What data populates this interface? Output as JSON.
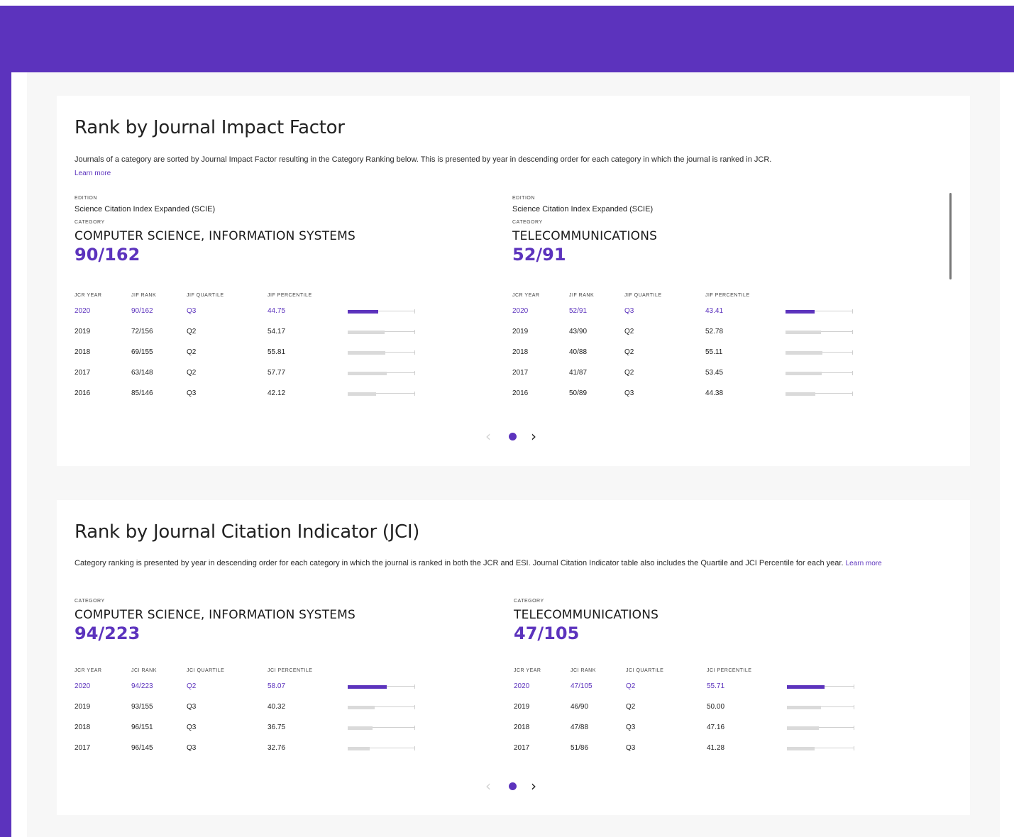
{
  "colors": {
    "accent": "#5c33bd",
    "background": "#f7f7f7",
    "card": "#ffffff"
  },
  "jif": {
    "title": "Rank by Journal Impact Factor",
    "description": "Journals of a category are sorted by Journal Impact Factor resulting in the Category Ranking below. This is presented by year in descending order for each category in which the journal is ranked in JCR.",
    "learn_more": "Learn more",
    "headers": {
      "year": "JCR YEAR",
      "rank": "JIF RANK",
      "quartile": "JIF QUARTILE",
      "percentile": "JIF PERCENTILE"
    },
    "categories": [
      {
        "edition_label": "EDITION",
        "edition": "Science Citation Index Expanded (SCIE)",
        "category_label": "CATEGORY",
        "name": "COMPUTER SCIENCE, INFORMATION SYSTEMS",
        "rank": "90/162",
        "rows": [
          {
            "year": "2020",
            "rank": "90/162",
            "quartile": "Q3",
            "percentile": "44.75",
            "pct": 44.75
          },
          {
            "year": "2019",
            "rank": "72/156",
            "quartile": "Q2",
            "percentile": "54.17",
            "pct": 54.17
          },
          {
            "year": "2018",
            "rank": "69/155",
            "quartile": "Q2",
            "percentile": "55.81",
            "pct": 55.81
          },
          {
            "year": "2017",
            "rank": "63/148",
            "quartile": "Q2",
            "percentile": "57.77",
            "pct": 57.77
          },
          {
            "year": "2016",
            "rank": "85/146",
            "quartile": "Q3",
            "percentile": "42.12",
            "pct": 42.12
          }
        ]
      },
      {
        "edition_label": "EDITION",
        "edition": "Science Citation Index Expanded (SCIE)",
        "category_label": "CATEGORY",
        "name": "TELECOMMUNICATIONS",
        "rank": "52/91",
        "rows": [
          {
            "year": "2020",
            "rank": "52/91",
            "quartile": "Q3",
            "percentile": "43.41",
            "pct": 43.41
          },
          {
            "year": "2019",
            "rank": "43/90",
            "quartile": "Q2",
            "percentile": "52.78",
            "pct": 52.78
          },
          {
            "year": "2018",
            "rank": "40/88",
            "quartile": "Q2",
            "percentile": "55.11",
            "pct": 55.11
          },
          {
            "year": "2017",
            "rank": "41/87",
            "quartile": "Q2",
            "percentile": "53.45",
            "pct": 53.45
          },
          {
            "year": "2016",
            "rank": "50/89",
            "quartile": "Q3",
            "percentile": "44.38",
            "pct": 44.38
          }
        ]
      }
    ]
  },
  "jci": {
    "title": "Rank by Journal Citation Indicator (JCI)",
    "description": "Category ranking is presented by year in descending order for each category in which the journal is ranked in both the JCR and ESI. Journal Citation Indicator table also includes the Quartile and JCI Percentile for each year.",
    "learn_more": "Learn more",
    "headers": {
      "year": "JCR YEAR",
      "rank": "JCI RANK",
      "quartile": "JCI QUARTILE",
      "percentile": "JCI PERCENTILE"
    },
    "categories": [
      {
        "category_label": "CATEGORY",
        "name": "COMPUTER SCIENCE, INFORMATION SYSTEMS",
        "rank": "94/223",
        "rows": [
          {
            "year": "2020",
            "rank": "94/223",
            "quartile": "Q2",
            "percentile": "58.07",
            "pct": 58.07
          },
          {
            "year": "2019",
            "rank": "93/155",
            "quartile": "Q3",
            "percentile": "40.32",
            "pct": 40.32
          },
          {
            "year": "2018",
            "rank": "96/151",
            "quartile": "Q3",
            "percentile": "36.75",
            "pct": 36.75
          },
          {
            "year": "2017",
            "rank": "96/145",
            "quartile": "Q3",
            "percentile": "32.76",
            "pct": 32.76
          }
        ]
      },
      {
        "category_label": "CATEGORY",
        "name": "TELECOMMUNICATIONS",
        "rank": "47/105",
        "rows": [
          {
            "year": "2020",
            "rank": "47/105",
            "quartile": "Q2",
            "percentile": "55.71",
            "pct": 55.71
          },
          {
            "year": "2019",
            "rank": "46/90",
            "quartile": "Q2",
            "percentile": "50.00",
            "pct": 50.0
          },
          {
            "year": "2018",
            "rank": "47/88",
            "quartile": "Q3",
            "percentile": "47.16",
            "pct": 47.16
          },
          {
            "year": "2017",
            "rank": "51/86",
            "quartile": "Q3",
            "percentile": "41.28",
            "pct": 41.28
          }
        ]
      }
    ]
  },
  "pager": {
    "prev_icon": "chevron-left-icon",
    "next_icon": "chevron-right-icon",
    "prev": "‹",
    "next": "›"
  }
}
